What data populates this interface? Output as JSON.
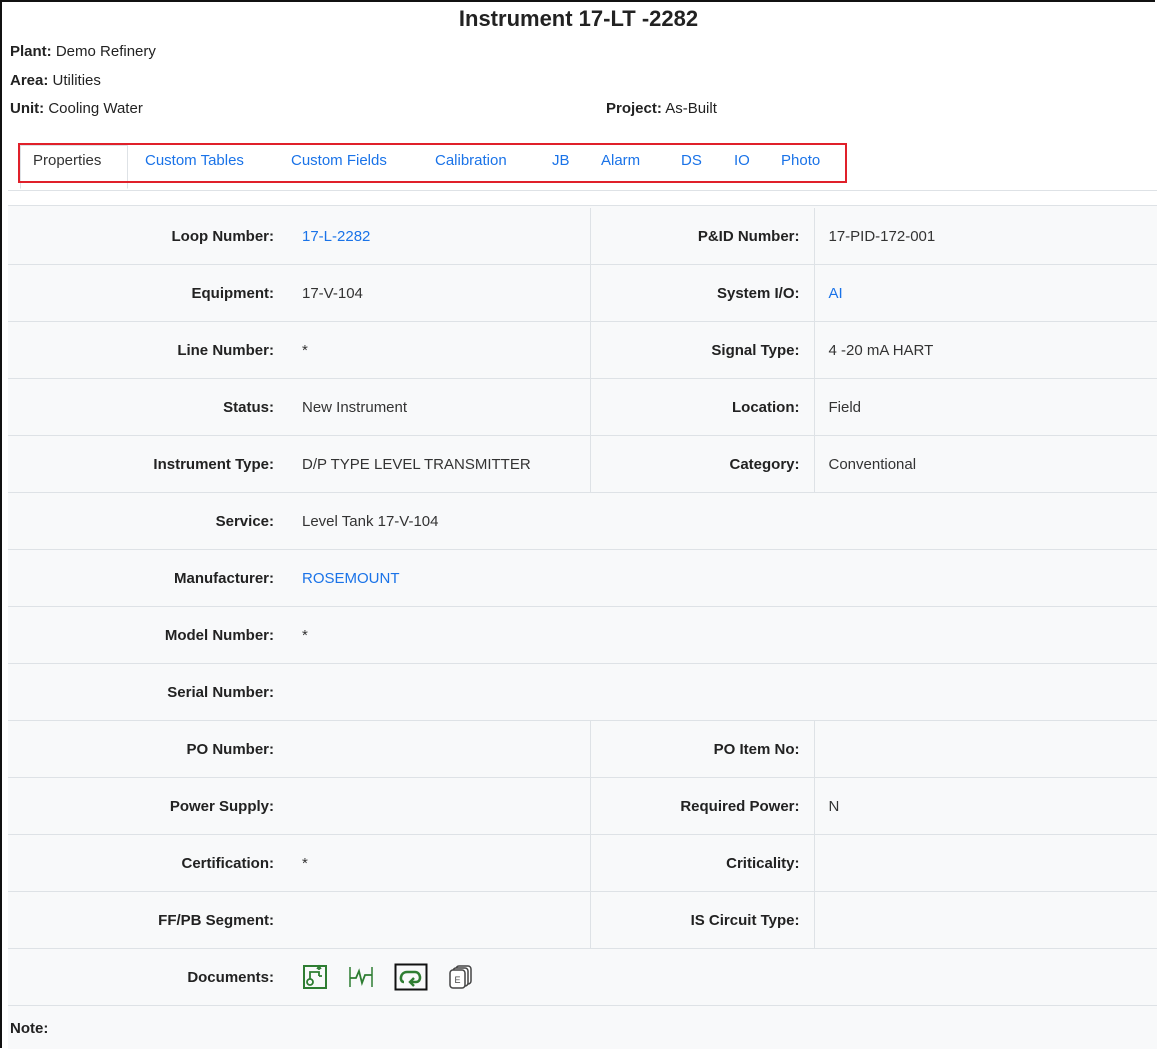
{
  "header": {
    "title": "Instrument 17-LT -2282",
    "plant_label": "Plant:",
    "plant": "Demo Refinery",
    "area_label": "Area:",
    "area": "Utilities",
    "unit_label": "Unit:",
    "unit": "Cooling Water",
    "project_label": "Project:",
    "project": "As-Built"
  },
  "tabs": [
    {
      "label": "Properties",
      "active": true
    },
    {
      "label": "Custom Tables"
    },
    {
      "label": "Custom Fields"
    },
    {
      "label": "Calibration"
    },
    {
      "label": "JB"
    },
    {
      "label": "Alarm"
    },
    {
      "label": "DS"
    },
    {
      "label": "IO"
    },
    {
      "label": "Photo"
    }
  ],
  "rows": [
    {
      "l1": "Loop Number:",
      "v1": "17-L-2282",
      "l2": "P&ID Number:",
      "v2": "17-PID-172-001"
    },
    {
      "l1": "Equipment:",
      "v1": "17-V-104",
      "l2": "System I/O:",
      "v2": "AI"
    },
    {
      "l1": "Line Number:",
      "v1": "*",
      "l2": "Signal Type:",
      "v2": "4 -20 mA HART"
    },
    {
      "l1": "Status:",
      "v1": "New Instrument",
      "l2": "Location:",
      "v2": "Field"
    },
    {
      "l1": "Instrument Type:",
      "v1": "D/P TYPE LEVEL TRANSMITTER",
      "l2": "Category:",
      "v2": "Conventional"
    },
    {
      "l1": "Service:",
      "v1": "Level Tank 17-V-104"
    },
    {
      "l1": "Manufacturer:",
      "v1": "ROSEMOUNT"
    },
    {
      "l1": "Model Number:",
      "v1": "*"
    },
    {
      "l1": "Serial Number:",
      "v1": ""
    },
    {
      "l1": "PO Number:",
      "v1": "",
      "l2": "PO Item No:",
      "v2": ""
    },
    {
      "l1": "Power Supply:",
      "v1": "",
      "l2": "Required Power:",
      "v2": "N"
    },
    {
      "l1": "Certification:",
      "v1": "*",
      "l2": "Criticality:",
      "v2": ""
    },
    {
      "l1": "FF/PB Segment:",
      "v1": "",
      "l2": "IS Circuit Type:",
      "v2": ""
    }
  ],
  "documents_label": "Documents:",
  "document_icons": [
    "loop-diagram-icon",
    "signal-wave-icon",
    "loop-arrow-icon",
    "electrical-docs-icon"
  ],
  "note_label": "Note:",
  "colors": {
    "link": "#1a73e8",
    "highlight": "#e0202a",
    "panel": "#f8f9fa",
    "icon_green": "#2e7d32"
  }
}
